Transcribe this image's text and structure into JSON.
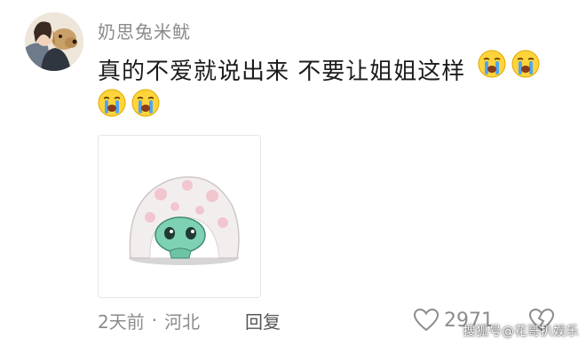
{
  "comment": {
    "username": "奶思兔米鱿",
    "text": "真的不爱就说出来 不要让姐姐这样",
    "time": "2天前",
    "location": "河北",
    "separator": "·",
    "reply_label": "回复",
    "like_count": "2971"
  },
  "icons": {
    "crying": "crying-face-emoji",
    "like": "heart-icon",
    "dislike": "broken-heart-icon"
  },
  "watermark": "搜狐号@花哥扒娱乐"
}
